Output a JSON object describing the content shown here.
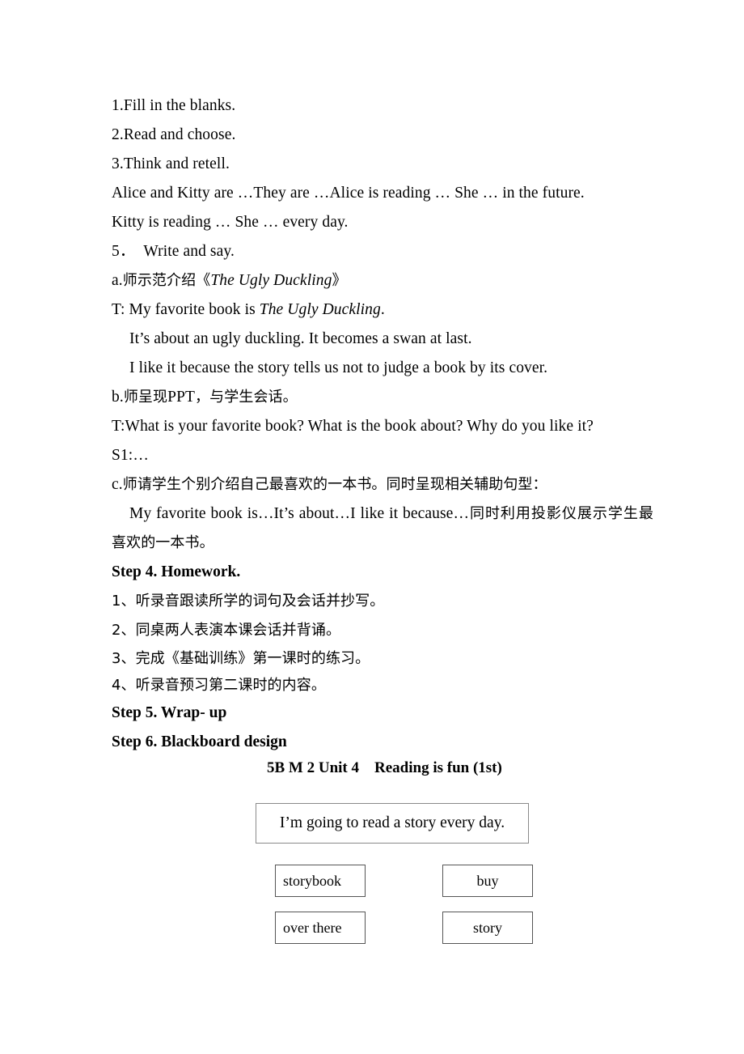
{
  "document": {
    "type": "lesson-plan-page",
    "page_background": "#ffffff",
    "text_color": "#000000"
  },
  "content": {
    "activities": [
      {
        "id": "activity-1",
        "text": "1.Fill in the blanks."
      },
      {
        "id": "activity-2",
        "text": "2.Read and choose."
      },
      {
        "id": "activity-3",
        "text": "3.Think and retell."
      }
    ],
    "retell_prompt_line1": "Alice and Kitty are …They are …Alice is reading … She … in the future.",
    "retell_prompt_line2": "Kitty is reading … She … every day.",
    "write_and_say": {
      "number": "5．",
      "label": "Write and say."
    },
    "step_a": {
      "prefix": "a.",
      "chinese": "师示范介绍",
      "bracket_open": "《",
      "book_title": "The Ugly Duckling",
      "bracket_close": "》"
    },
    "teacher_model": {
      "line1_prefix": "T: My favorite book is ",
      "line1_title": "The Ugly Duckling",
      "line1_suffix": ".",
      "line2": "It’s about an ugly duckling. It becomes a swan at last.",
      "line3": "I like it because the story tells us not to judge a book by its cover."
    },
    "step_b": {
      "prefix": "b.",
      "chinese_part1": "师呈现",
      "latin_part": "PPT",
      "chinese_part2": "，与学生会话。"
    },
    "teacher_questions": "T:What is your favorite book? What is the book about? Why do you like it?",
    "student_answer": "S1:…",
    "step_c": {
      "prefix": "c.",
      "chinese": "师请学生个别介绍自己最喜欢的一本书。同时呈现相关辅助句型："
    },
    "sentence_frames": {
      "latin": "My favorite book is…It’s about…I like it because…",
      "chinese_tail": "同时利用投影仪展示学生最",
      "chinese_wrap": "喜欢的一本书。"
    },
    "step4": {
      "heading": "Step 4. Homework.",
      "items": [
        "1、听录音跟读所学的词句及会话并抄写。",
        "2、同桌两人表演本课会话并背诵。",
        "3、完成《基础训练》第一课时的练习。",
        "4、听录音预习第二课时的内容。"
      ]
    },
    "step5": {
      "heading": "Step 5. Wrap- up"
    },
    "step6": {
      "heading": "Step 6. Blackboard design"
    }
  },
  "blackboard": {
    "title": "5B M 2 Unit 4 Reading is fun (1st)",
    "main_sentence": "I’m going to read a story every day.",
    "word_cards": [
      {
        "id": "card-storybook",
        "label": "storybook",
        "column": "left",
        "row": 1
      },
      {
        "id": "card-buy",
        "label": "buy",
        "column": "right",
        "row": 1
      },
      {
        "id": "card-over-there",
        "label": "over there",
        "column": "left",
        "row": 2
      },
      {
        "id": "card-story",
        "label": "story",
        "column": "right",
        "row": 2
      }
    ],
    "border_color_main": "#8a8a8a",
    "border_color_card": "#555555"
  }
}
